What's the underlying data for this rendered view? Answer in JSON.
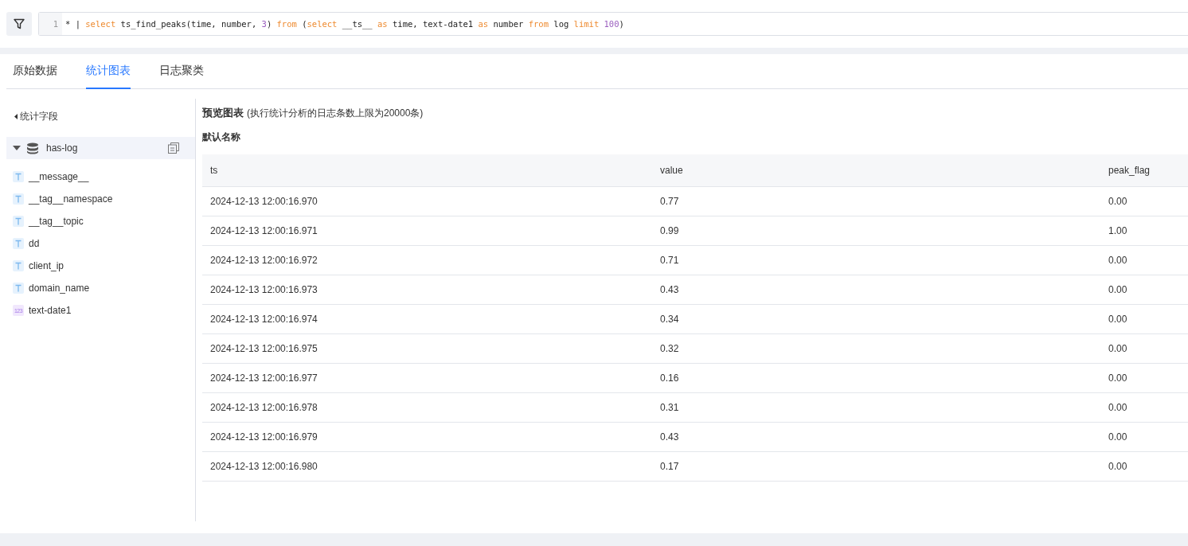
{
  "query": {
    "line_number": "1",
    "tokens": [
      {
        "kind": "plain",
        "text": "* | "
      },
      {
        "kind": "keyword",
        "text": "select"
      },
      {
        "kind": "plain",
        "text": " ts_find_peaks(time, number, "
      },
      {
        "kind": "number",
        "text": "3"
      },
      {
        "kind": "plain",
        "text": ") "
      },
      {
        "kind": "keyword",
        "text": "from"
      },
      {
        "kind": "plain",
        "text": " ("
      },
      {
        "kind": "keyword",
        "text": "select"
      },
      {
        "kind": "plain",
        "text": " __ts__ "
      },
      {
        "kind": "keyword",
        "text": "as"
      },
      {
        "kind": "plain",
        "text": " time, text-date1 "
      },
      {
        "kind": "keyword",
        "text": "as"
      },
      {
        "kind": "plain",
        "text": " number "
      },
      {
        "kind": "keyword",
        "text": "from"
      },
      {
        "kind": "plain",
        "text": " log "
      },
      {
        "kind": "keyword",
        "text": "limit "
      },
      {
        "kind": "number",
        "text": "100"
      },
      {
        "kind": "plain",
        "text": ")"
      }
    ]
  },
  "tabs": [
    {
      "label": "原始数据",
      "selected": false
    },
    {
      "label": "统计图表",
      "selected": true
    },
    {
      "label": "日志聚类",
      "selected": false
    }
  ],
  "sidebar": {
    "title": "统计字段",
    "logstore": {
      "name": "has-log",
      "expanded": true
    },
    "fields": [
      {
        "kind": "text",
        "name": "__message__"
      },
      {
        "kind": "text",
        "name": "__tag__namespace"
      },
      {
        "kind": "text",
        "name": "__tag__topic"
      },
      {
        "kind": "text",
        "name": "dd"
      },
      {
        "kind": "text",
        "name": "client_ip"
      },
      {
        "kind": "text",
        "name": "domain_name"
      },
      {
        "kind": "number",
        "name": "text-date1",
        "type_label": "123"
      }
    ]
  },
  "preview": {
    "title": "预览图表",
    "note": "(执行统计分析的日志条数上限为20000条)",
    "chart_name": "默认名称"
  },
  "table": {
    "columns": [
      "ts",
      "value",
      "peak_flag"
    ],
    "rows": [
      [
        "2024-12-13 12:00:16.970",
        "0.77",
        "0.00"
      ],
      [
        "2024-12-13 12:00:16.971",
        "0.99",
        "1.00"
      ],
      [
        "2024-12-13 12:00:16.972",
        "0.71",
        "0.00"
      ],
      [
        "2024-12-13 12:00:16.973",
        "0.43",
        "0.00"
      ],
      [
        "2024-12-13 12:00:16.974",
        "0.34",
        "0.00"
      ],
      [
        "2024-12-13 12:00:16.975",
        "0.32",
        "0.00"
      ],
      [
        "2024-12-13 12:00:16.977",
        "0.16",
        "0.00"
      ],
      [
        "2024-12-13 12:00:16.978",
        "0.31",
        "0.00"
      ],
      [
        "2024-12-13 12:00:16.979",
        "0.43",
        "0.00"
      ],
      [
        "2024-12-13 12:00:16.980",
        "0.17",
        "0.00"
      ]
    ]
  }
}
